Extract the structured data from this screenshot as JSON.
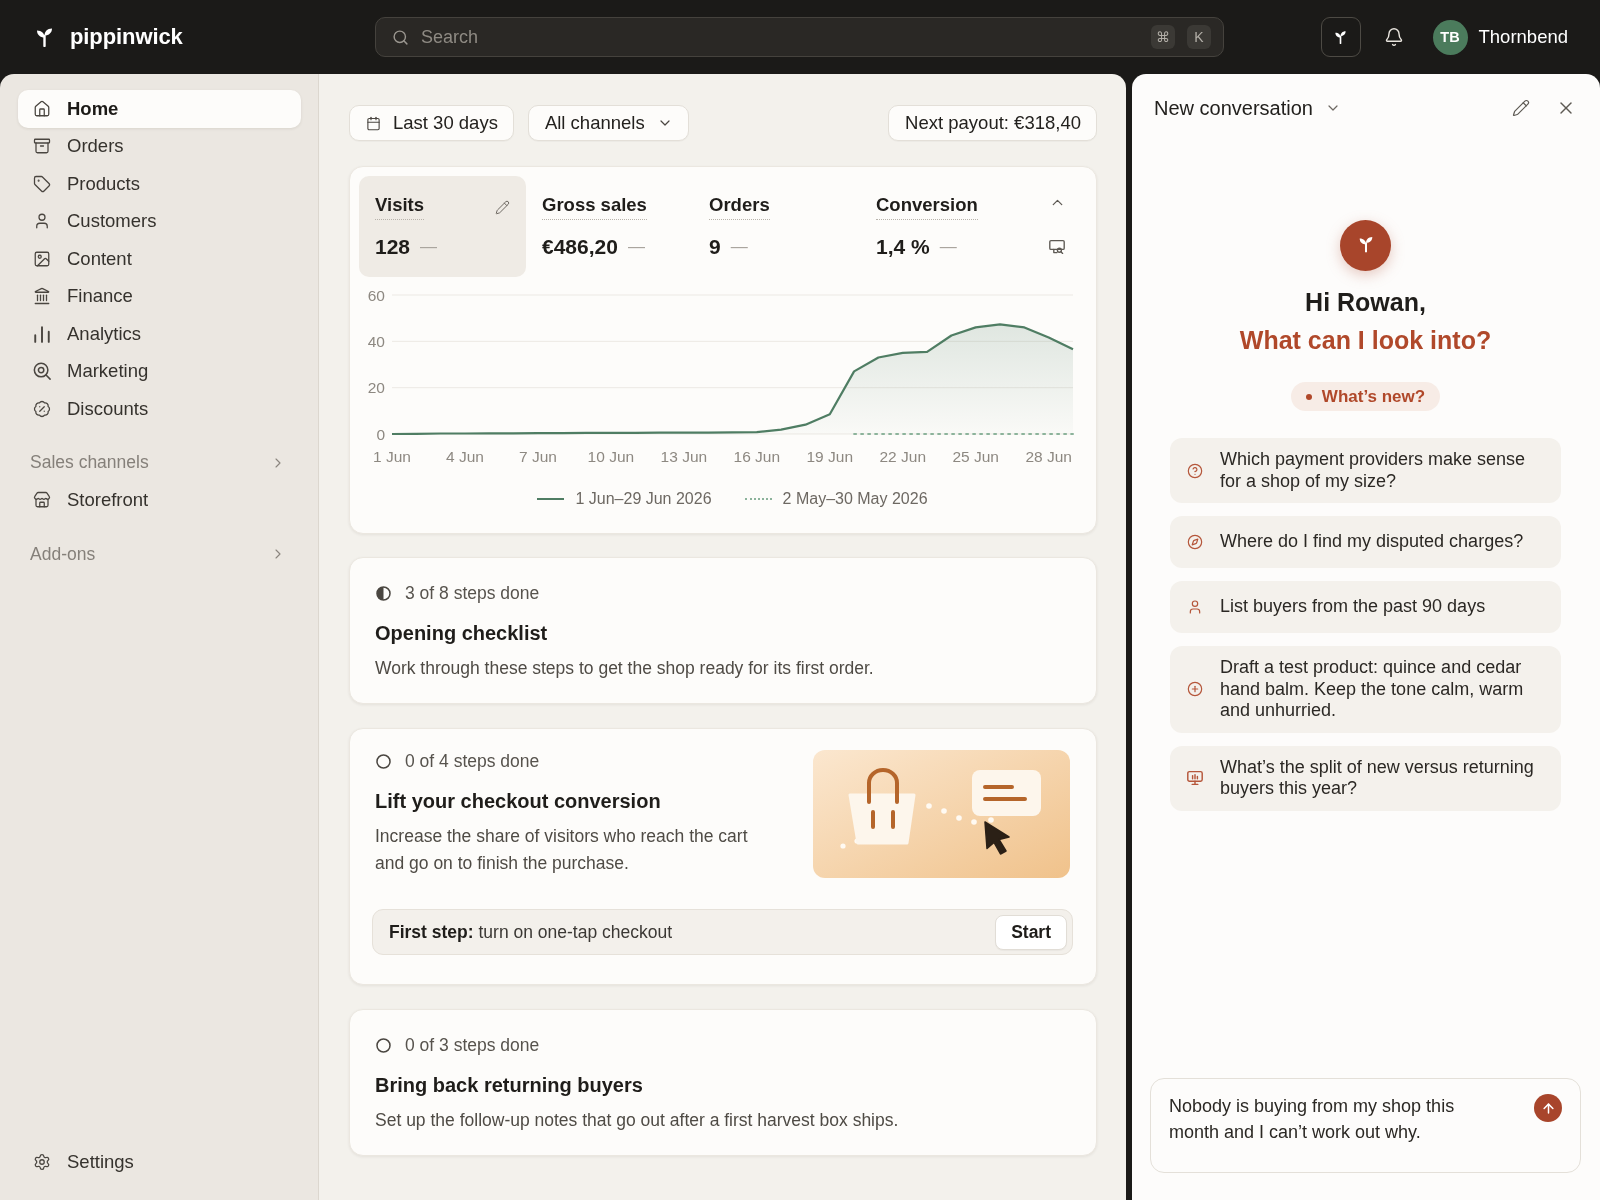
{
  "app": {
    "name": "pippinwick"
  },
  "search": {
    "placeholder": "Search",
    "shortcut": [
      "⌘",
      "K"
    ]
  },
  "account": {
    "initials": "TB",
    "name": "Thornbend"
  },
  "sidebar": {
    "items": [
      {
        "label": "Home",
        "selected": true
      },
      {
        "label": "Orders",
        "selected": false
      },
      {
        "label": "Products",
        "selected": false
      },
      {
        "label": "Customers",
        "selected": false
      },
      {
        "label": "Content",
        "selected": false
      },
      {
        "label": "Finance",
        "selected": false
      },
      {
        "label": "Analytics",
        "selected": false
      },
      {
        "label": "Marketing",
        "selected": false
      },
      {
        "label": "Discounts",
        "selected": false
      }
    ],
    "sections": [
      {
        "title": "Sales channels",
        "items": [
          {
            "label": "Storefront",
            "selected": false
          }
        ]
      },
      {
        "title": "Add-ons"
      }
    ],
    "footer": [
      {
        "label": "Settings",
        "selected": false
      }
    ]
  },
  "filters": {
    "date_range": "Last 30 days",
    "channel": "All channels",
    "payout": "Next payout: €318,40"
  },
  "overview": {
    "expanded": true,
    "metrics": [
      {
        "label": "Visits",
        "value": "128",
        "change": "—",
        "selected": true
      },
      {
        "label": "Gross sales",
        "value": "€486,20",
        "change": "—",
        "selected": false
      },
      {
        "label": "Orders",
        "value": "9",
        "change": "—",
        "selected": false
      },
      {
        "label": "Conversion",
        "value": "1,4 %",
        "change": "—",
        "selected": false
      }
    ],
    "chart_data": {
      "type": "area",
      "legend": "bottom",
      "categories": [
        "1 Jun",
        null,
        null,
        "4 Jun",
        null,
        null,
        "7 Jun",
        null,
        null,
        "10 Jun",
        null,
        null,
        "13 Jun",
        null,
        null,
        "16 Jun",
        null,
        null,
        "19 Jun",
        null,
        null,
        "22 Jun",
        null,
        null,
        "25 Jun",
        null,
        null,
        "28 Jun",
        null
      ],
      "series": [
        {
          "name": "1 Jun–29 Jun 2026",
          "color": "#4f7d63",
          "line_style": "solid",
          "values": [
            0,
            0.1,
            0.2,
            0.2,
            0.3,
            0.3,
            0.4,
            0.4,
            0.5,
            0.5,
            0.5,
            0.6,
            0.6,
            0.6,
            0.7,
            0.8,
            1.9,
            4,
            8.5,
            27,
            33,
            35,
            35.5,
            42.5,
            46,
            47.3,
            46,
            41.6,
            36.6
          ]
        },
        {
          "name": "2 May–30 May 2026",
          "type": "line",
          "color": "#8cb39b",
          "line_style": "dotted",
          "values": [
            null,
            null,
            null,
            null,
            null,
            null,
            null,
            null,
            null,
            null,
            null,
            null,
            null,
            null,
            null,
            null,
            null,
            null,
            null,
            0,
            0,
            0,
            0,
            0,
            0,
            0,
            0,
            0,
            0
          ]
        }
      ],
      "ylim": [
        0,
        60
      ],
      "yticks": [
        0,
        20,
        40,
        60
      ]
    }
  },
  "checklists": [
    {
      "kind": "basic",
      "started": true,
      "progress": "3 of 8 steps done",
      "title": "Opening checklist",
      "description": "Work through these steps to get the shop ready for its first order."
    },
    {
      "kind": "featured",
      "started": false,
      "progress": "0 of 4 steps done",
      "title": "Lift your checkout conversion",
      "description": "Increase the share of visitors who reach the cart and go on to finish the purchase.",
      "first_step": {
        "text": "**First step:** turn on one-tap checkout",
        "button": "Start"
      }
    },
    {
      "kind": "basic",
      "started": false,
      "progress": "0 of 3 steps done",
      "title": "Bring back returning buyers",
      "description": "Set up the follow-up notes that go out after a first harvest box ships."
    }
  ],
  "chat": {
    "title": "New conversation",
    "greeting": "Hi Rowan,",
    "prompt": "What can I look into?",
    "whats_new": "What’s new?",
    "suggestions": [
      {
        "text": "Which payment providers make sense for a shop of my size?"
      },
      {
        "text": "Where do I find my disputed charges?"
      },
      {
        "text": "List buyers from the past 90 days"
      },
      {
        "text": "Draft a test product: quince and cedar hand balm. Keep the tone calm, warm and unhurried."
      },
      {
        "text": "What’s the split of new versus returning buyers this year?"
      }
    ],
    "message": {
      "value": "Nobody is buying from my shop this month and I can’t work out why."
    }
  }
}
